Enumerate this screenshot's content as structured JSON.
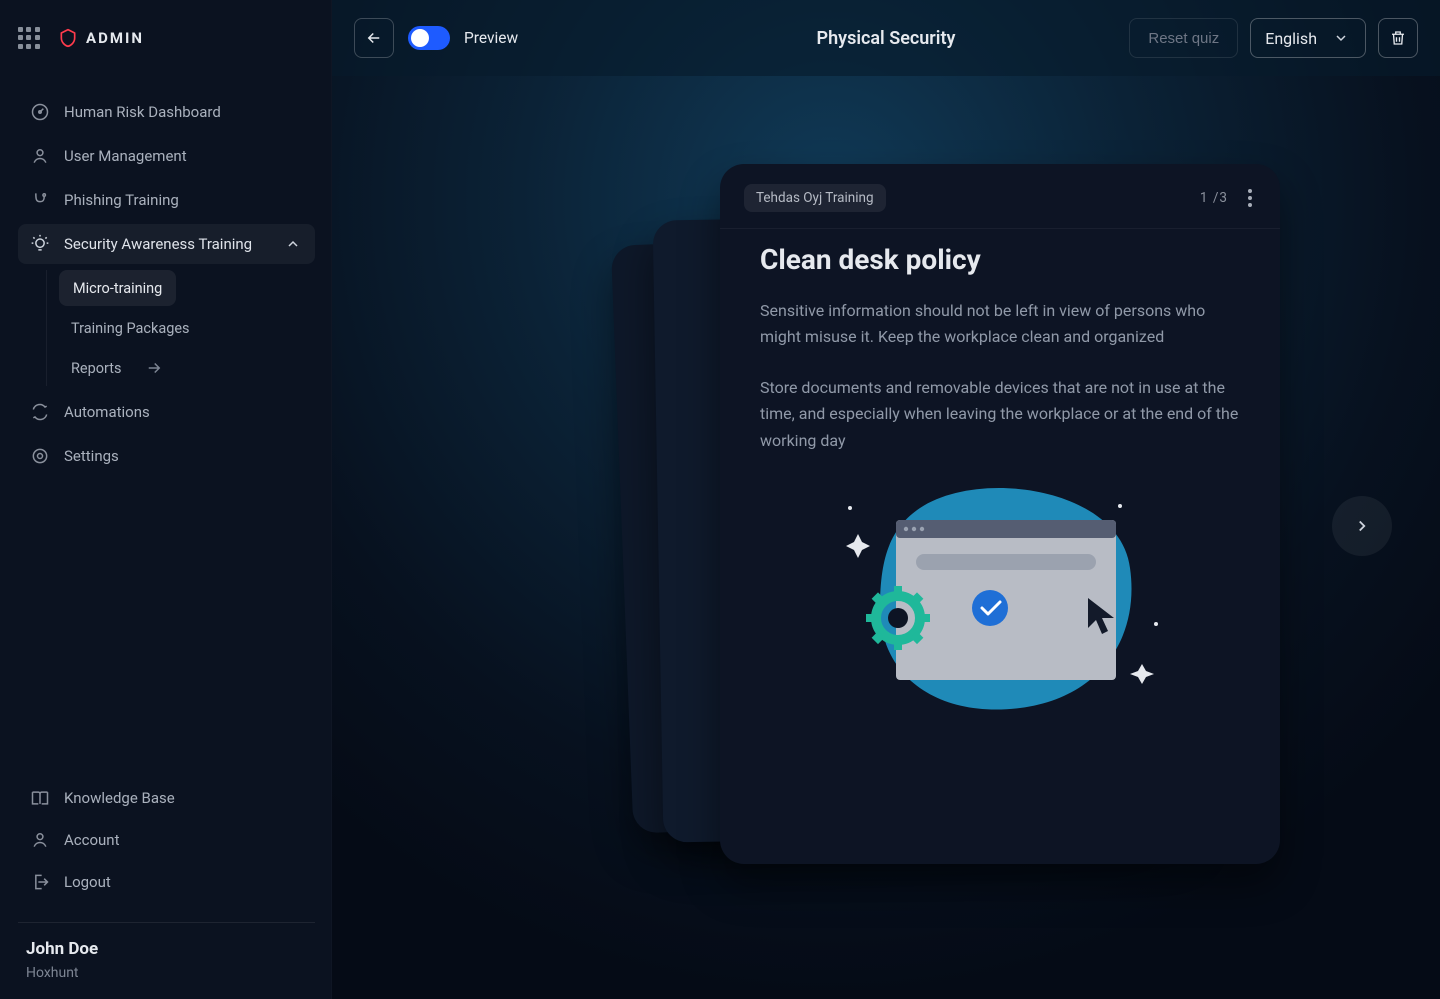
{
  "brand": {
    "name": "ADMIN"
  },
  "sidebar": {
    "items": [
      {
        "label": "Human Risk Dashboard",
        "icon": "risk-gauge-icon"
      },
      {
        "label": "User Management",
        "icon": "user-icon"
      },
      {
        "label": "Phishing Training",
        "icon": "hook-icon"
      },
      {
        "label": "Security Awareness Training",
        "icon": "lightbulb-icon",
        "expanded": true
      },
      {
        "label": "Automations",
        "icon": "loop-icon"
      },
      {
        "label": "Settings",
        "icon": "target-icon"
      }
    ],
    "sub_items": [
      {
        "label": "Micro-training",
        "active": true
      },
      {
        "label": "Training Packages"
      },
      {
        "label": "Reports",
        "has_arrow": true
      }
    ],
    "footer_items": [
      {
        "label": "Knowledge Base",
        "icon": "book-icon"
      },
      {
        "label": "Account",
        "icon": "person-icon"
      },
      {
        "label": "Logout",
        "icon": "logout-icon"
      }
    ]
  },
  "user": {
    "name": "John Doe",
    "org": "Hoxhunt"
  },
  "topbar": {
    "preview_label": "Preview",
    "page_title": "Physical Security",
    "reset_label": "Reset quiz",
    "language": "English"
  },
  "card": {
    "tag": "Tehdas Oyj Training",
    "counter_current": "1",
    "counter_separator": " /",
    "counter_total": "3",
    "title": "Clean desk policy",
    "paragraph1": "Sensitive information should not be left in view of persons who might misuse it. Keep the workplace clean and organized",
    "paragraph2": "Store documents and removable devices that are not in use at the time, and especially when leaving the workplace or at the end of the working day"
  }
}
